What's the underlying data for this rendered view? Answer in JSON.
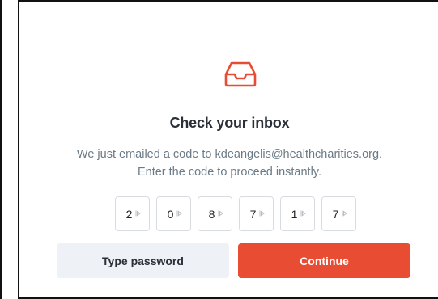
{
  "dialog": {
    "title": "Check your inbox",
    "message_line1": "We just emailed a code to kdeangelis@healthcharities.org.",
    "message_line2": "Enter the code to proceed instantly.",
    "icon": "inbox-tray-icon",
    "accent_color": "#e84c33"
  },
  "code": {
    "digits": [
      "2",
      "0",
      "8",
      "7",
      "1",
      "7"
    ],
    "digit_icon": "autofill-indicator-icon"
  },
  "buttons": {
    "secondary_label": "Type password",
    "primary_label": "Continue",
    "secondary_bg": "#eef1f5",
    "primary_bg": "#e84c33"
  }
}
